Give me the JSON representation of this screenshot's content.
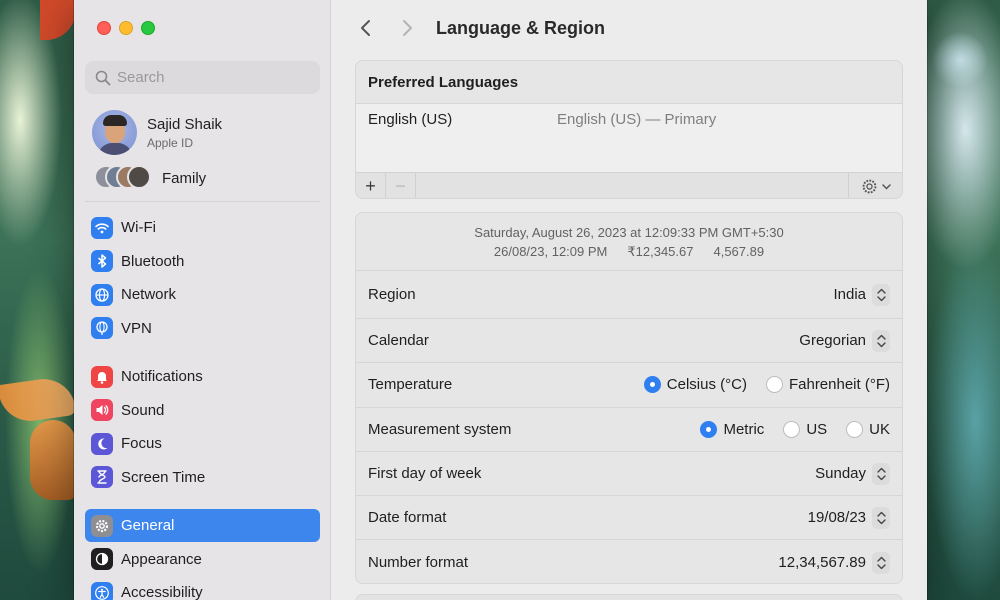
{
  "sidebar": {
    "search_placeholder": "Search",
    "profile": {
      "name": "Sajid Shaik",
      "subtitle": "Apple ID"
    },
    "family_label": "Family",
    "items": [
      {
        "label": "Wi-Fi",
        "icon": "wifi-icon",
        "color": "#2f7ff0"
      },
      {
        "label": "Bluetooth",
        "icon": "bluetooth-icon",
        "color": "#2f7ff0"
      },
      {
        "label": "Network",
        "icon": "globe-icon",
        "color": "#2f7ff0"
      },
      {
        "label": "VPN",
        "icon": "vpn-globe-icon",
        "color": "#2f7ff0"
      },
      {
        "label": "Notifications",
        "icon": "bell-icon",
        "color": "#f04545"
      },
      {
        "label": "Sound",
        "icon": "speaker-icon",
        "color": "#f04561"
      },
      {
        "label": "Focus",
        "icon": "moon-icon",
        "color": "#5b57d6"
      },
      {
        "label": "Screen Time",
        "icon": "hourglass-icon",
        "color": "#5b57d6"
      },
      {
        "label": "General",
        "icon": "gear-icon",
        "color": "#8e8e93",
        "active": true
      },
      {
        "label": "Appearance",
        "icon": "appearance-icon",
        "color": "#1f1f1f"
      },
      {
        "label": "Accessibility",
        "icon": "accessibility-icon",
        "color": "#2f7ff0"
      }
    ]
  },
  "main": {
    "title": "Language & Region",
    "preferred": {
      "heading": "Preferred Languages",
      "language": "English (US)",
      "detail": "English (US) — Primary"
    },
    "preview": {
      "line1": "Saturday, August 26, 2023 at 12:09:33 PM GMT+5:30",
      "date": "26/08/23, 12:09 PM",
      "currency": "₹12,345.67",
      "number": "4,567.89"
    },
    "settings": {
      "region": {
        "label": "Region",
        "value": "India"
      },
      "calendar": {
        "label": "Calendar",
        "value": "Gregorian"
      },
      "temperature": {
        "label": "Temperature",
        "options": [
          "Celsius (°C)",
          "Fahrenheit (°F)"
        ],
        "selected": "Celsius (°C)"
      },
      "measurement": {
        "label": "Measurement system",
        "options": [
          "Metric",
          "US",
          "UK"
        ],
        "selected": "Metric"
      },
      "first_day": {
        "label": "First day of week",
        "value": "Sunday"
      },
      "date_format": {
        "label": "Date format",
        "value": "19/08/23"
      },
      "number_format": {
        "label": "Number format",
        "value": "12,34,567.89"
      }
    }
  }
}
